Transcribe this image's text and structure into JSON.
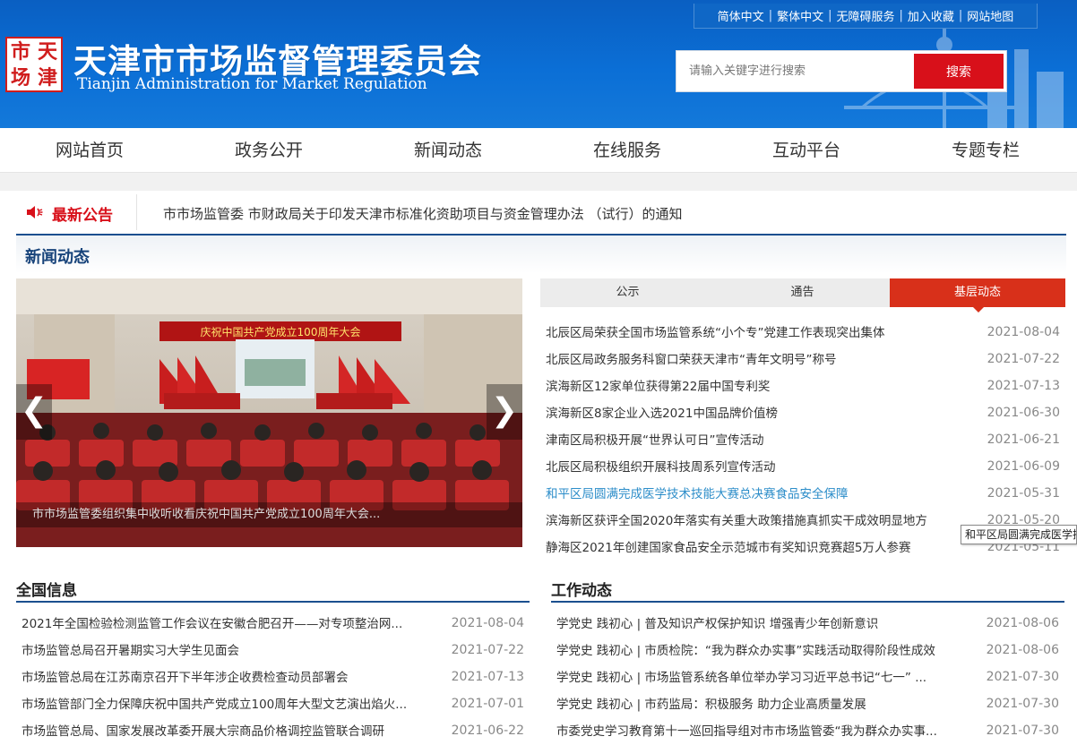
{
  "header": {
    "toplinks": [
      "简体中文",
      "繁体中文",
      "无障碍服务",
      "加入收藏",
      "网站地图"
    ],
    "seal": [
      "市",
      "天",
      "场",
      "津"
    ],
    "title_cn": "天津市市场监督管理委员会",
    "title_en": "Tianjin Administration for Market Regulation",
    "search_placeholder": "请输入关键字进行搜索",
    "search_button": "搜索"
  },
  "nav": [
    "网站首页",
    "政务公开",
    "新闻动态",
    "在线服务",
    "互动平台",
    "专题专栏"
  ],
  "notice": {
    "label": "最新公告",
    "text": "市市场监管委 市财政局关于印发天津市标准化资助项目与资金管理办法 （试行）的通知"
  },
  "news": {
    "title": "新闻动态",
    "photo_banner": "庆祝中国共产党成立100周年大会",
    "photo_caption": "市市场监管委组织集中收听收看庆祝中国共产党成立100周年大会...",
    "tabs": [
      "公示",
      "通告",
      "基层动态"
    ],
    "items": [
      {
        "title": "北辰区局荣获全国市场监管系统“小个专”党建工作表现突出集体",
        "date": "2021-08-04"
      },
      {
        "title": "北辰区局政务服务科窗口荣获天津市“青年文明号”称号",
        "date": "2021-07-22"
      },
      {
        "title": "滨海新区12家单位获得第22届中国专利奖",
        "date": "2021-07-13"
      },
      {
        "title": "滨海新区8家企业入选2021中国品牌价值榜",
        "date": "2021-06-30"
      },
      {
        "title": "津南区局积极开展“世界认可日”宣传活动",
        "date": "2021-06-21"
      },
      {
        "title": "北辰区局积极组织开展科技周系列宣传活动",
        "date": "2021-06-09"
      },
      {
        "title": "和平区局圆满完成医学技术技能大赛总决赛食品安全保障",
        "date": "2021-05-31"
      },
      {
        "title": "滨海新区获评全国2020年落实有关重大政策措施真抓实干成效明显地方",
        "date": "2021-05-20"
      },
      {
        "title": "静海区2021年创建国家食品安全示范城市有奖知识竞赛超5万人参赛",
        "date": "2021-05-11"
      }
    ],
    "tooltip": "和平区局圆满完成医学技术"
  },
  "national": {
    "title": "全国信息",
    "items": [
      {
        "title": "2021年全国检验检测监管工作会议在安徽合肥召开——对专项整治网...",
        "date": "2021-08-04"
      },
      {
        "title": "市场监管总局召开暑期实习大学生见面会",
        "date": "2021-07-22"
      },
      {
        "title": "市场监管总局在江苏南京召开下半年涉企收费检查动员部署会",
        "date": "2021-07-13"
      },
      {
        "title": "市场监管部门全力保障庆祝中国共产党成立100周年大型文艺演出焰火...",
        "date": "2021-07-01"
      },
      {
        "title": "市场监管总局、国家发展改革委开展大宗商品价格调控监管联合调研",
        "date": "2021-06-22"
      }
    ]
  },
  "work": {
    "title": "工作动态",
    "items": [
      {
        "title": "学党史 践初心 | 普及知识产权保护知识 增强青少年创新意识",
        "date": "2021-08-06"
      },
      {
        "title": "学党史 践初心 | 市质检院：“我为群众办实事”实践活动取得阶段性成效",
        "date": "2021-08-06"
      },
      {
        "title": "学党史 践初心 | 市场监管系统各单位举办学习习近平总书记“七一” ...",
        "date": "2021-07-30"
      },
      {
        "title": "学党史 践初心 | 市药监局：积极服务 助力企业高质量发展",
        "date": "2021-07-30"
      },
      {
        "title": "市委党史学习教育第十一巡回指导组对市市场监管委“我为群众办实事...",
        "date": "2021-07-30"
      }
    ]
  },
  "colors": {
    "brand_blue": "#0b6fd6",
    "accent_red": "#d8101a",
    "tab_red": "#d8301a",
    "heading_blue": "#17437a"
  },
  "icons": [
    "speaker-icon",
    "chevron-left-icon",
    "chevron-right-icon"
  ]
}
